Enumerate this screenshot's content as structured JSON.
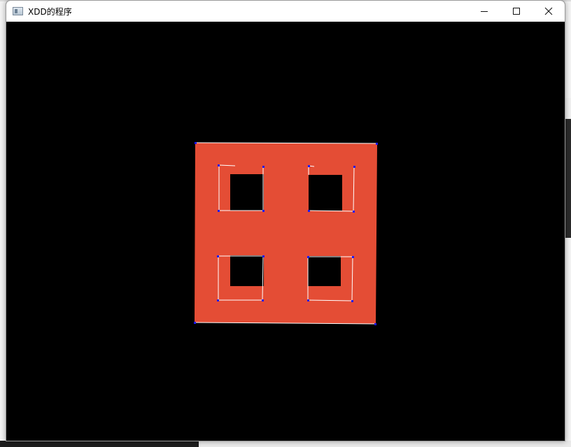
{
  "window": {
    "title": "XDD的程序",
    "controls": {
      "minimize_glyph": "—",
      "maximize_glyph": "☐",
      "close_glyph": "✕"
    }
  },
  "canvas": {
    "background_color": "#000000",
    "shape_fill_color": "#e44d35",
    "edge_color": "#ffffff",
    "vertex_color": "#0000cc",
    "description_icon": "app-window-icon"
  }
}
